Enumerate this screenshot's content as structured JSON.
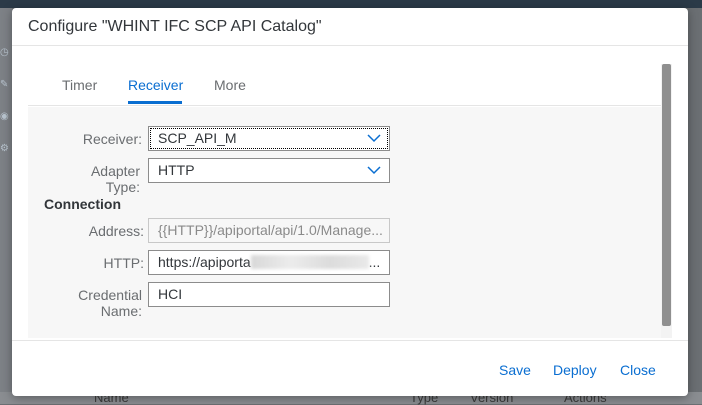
{
  "dialog": {
    "title": "Configure \"WHINT IFC SCP API Catalog\""
  },
  "tabs": [
    {
      "label": "Timer"
    },
    {
      "label": "Receiver",
      "selected": true
    },
    {
      "label": "More"
    }
  ],
  "form": {
    "receiver": {
      "label": "Receiver:",
      "value": "SCP_API_M"
    },
    "adapter_type": {
      "label_line1": "Adapter",
      "label_line2": "Type:",
      "value": "HTTP"
    },
    "connection_heading": "Connection",
    "address": {
      "label": "Address:",
      "value": "{{HTTP}}/apiportal/api/1.0/Manage..."
    },
    "http": {
      "label": "HTTP:",
      "value_prefix": "https://apiporta",
      "value_suffix": "..."
    },
    "credential_name": {
      "label_line1": "Credential",
      "label_line2": "Name:",
      "value": "HCI"
    }
  },
  "footer": {
    "save_label": "Save",
    "deploy_label": "Deploy",
    "close_label": "Close"
  },
  "background": {
    "columns": [
      "Name",
      "Type",
      "Version",
      "Actions"
    ]
  },
  "colors": {
    "accent": "#0a6ed1",
    "text": "#32363a",
    "label": "#6a6d70"
  }
}
